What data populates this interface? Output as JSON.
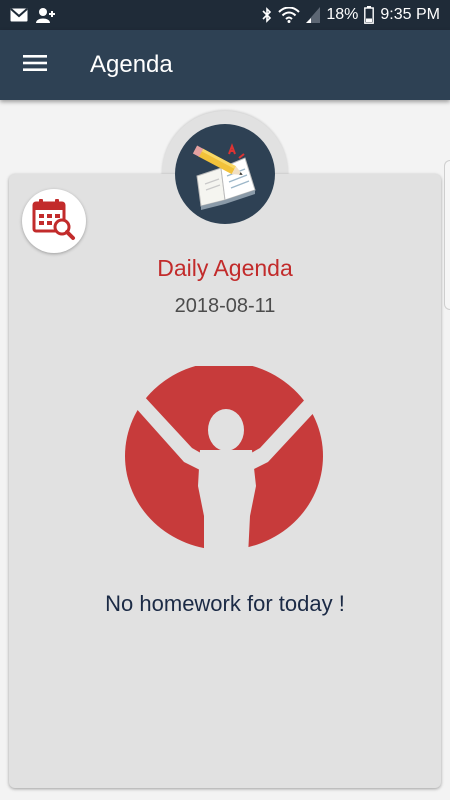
{
  "status_bar": {
    "battery": "18%",
    "time": "9:35 PM",
    "icons": [
      "gmail-icon",
      "person-add-icon",
      "bluetooth-icon",
      "wifi-icon",
      "signal-icon",
      "battery-icon"
    ]
  },
  "app_bar": {
    "title": "Agenda",
    "menu_icon": "hamburger-menu-icon"
  },
  "agenda": {
    "title": "Daily Agenda",
    "date": "2018-08-11",
    "empty_message": "No homework for today !",
    "logo_icon": "book-pencil-icon",
    "calendar_button_icon": "calendar-search-icon",
    "illustration": "cheering-person-silhouette"
  },
  "colors": {
    "status_bar": "#1f2b38",
    "app_bar": "#2e4154",
    "accent_red": "#c22b2b",
    "card": "#e1e1e1",
    "message_text": "#1b2a45"
  }
}
